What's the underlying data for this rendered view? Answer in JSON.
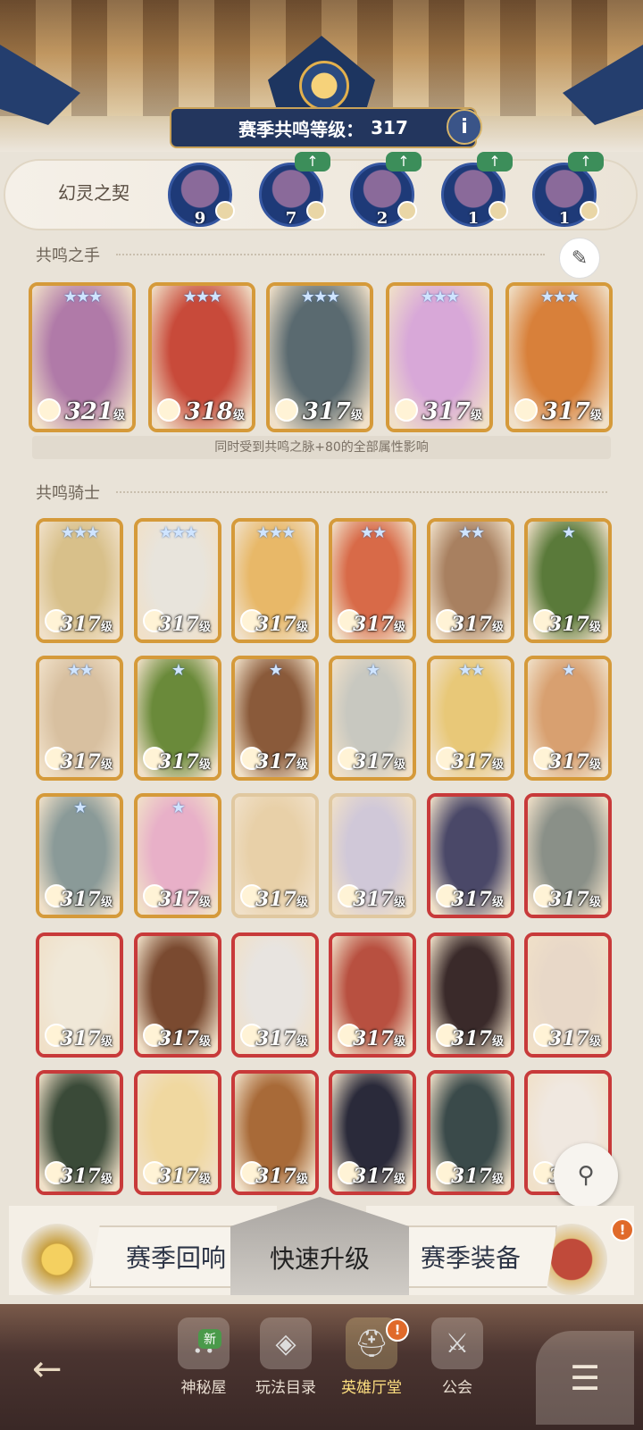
{
  "header": {
    "level_label": "赛季共鸣等级：",
    "level_value": "317",
    "info_label": "i"
  },
  "pact": {
    "label": "幻灵之契",
    "items": [
      {
        "count": "9",
        "upgrade": false
      },
      {
        "count": "7",
        "upgrade": true
      },
      {
        "count": "2",
        "upgrade": true
      },
      {
        "count": "1",
        "upgrade": true
      },
      {
        "count": "1",
        "upgrade": true
      }
    ],
    "upgrade_symbol": "↑"
  },
  "hands": {
    "title": "共鸣之手",
    "cards": [
      {
        "level": "321",
        "stars": "★★★",
        "color": "#b07aa8"
      },
      {
        "level": "318",
        "stars": "★★★",
        "color": "#c84a3a"
      },
      {
        "level": "317",
        "stars": "★★★",
        "color": "#5a6a70"
      },
      {
        "level": "317",
        "stars": "★★★",
        "color": "#d8a8d8"
      },
      {
        "level": "317",
        "stars": "★★★",
        "color": "#d8803a"
      }
    ],
    "note": "同时受到共鸣之脉+80的全部属性影响"
  },
  "knights": {
    "title": "共鸣骑士",
    "level_unit": "级",
    "rows": [
      [
        {
          "level": "317",
          "stars": "★★★",
          "color": "#d8c08a",
          "frame": "#d59a3a"
        },
        {
          "level": "317",
          "stars": "★★★",
          "color": "#e8e4dc",
          "frame": "#d59a3a"
        },
        {
          "level": "317",
          "stars": "★★★",
          "color": "#e8b868",
          "frame": "#d59a3a"
        },
        {
          "level": "317",
          "stars": "★★",
          "color": "#d86a48",
          "frame": "#d59a3a"
        },
        {
          "level": "317",
          "stars": "★★",
          "color": "#a88060",
          "frame": "#d59a3a"
        },
        {
          "level": "317",
          "stars": "★",
          "color": "#5a7a3a",
          "frame": "#d59a3a"
        }
      ],
      [
        {
          "level": "317",
          "stars": "★★",
          "color": "#d8c0a0",
          "frame": "#d59a3a"
        },
        {
          "level": "317",
          "stars": "★",
          "color": "#6a8a3a",
          "frame": "#d59a3a"
        },
        {
          "level": "317",
          "stars": "★",
          "color": "#8a5a3a",
          "frame": "#d59a3a"
        },
        {
          "level": "317",
          "stars": "★",
          "color": "#c8c8c0",
          "frame": "#d59a3a"
        },
        {
          "level": "317",
          "stars": "★★",
          "color": "#e8c878",
          "frame": "#d59a3a"
        },
        {
          "level": "317",
          "stars": "★",
          "color": "#d8a070",
          "frame": "#d59a3a"
        }
      ],
      [
        {
          "level": "317",
          "stars": "★",
          "color": "#8a9a98",
          "frame": "#d59a3a"
        },
        {
          "level": "317",
          "stars": "★",
          "color": "#e8b0c8",
          "frame": "#d59a3a"
        },
        {
          "level": "317",
          "stars": "",
          "color": "#e8d0a8",
          "frame": "#e0c8a0"
        },
        {
          "level": "317",
          "stars": "",
          "color": "#d0c8d8",
          "frame": "#e0c8a0"
        },
        {
          "level": "317",
          "stars": "",
          "color": "#4a4868",
          "frame": "#c83a3a"
        },
        {
          "level": "317",
          "stars": "",
          "color": "#8a9088",
          "frame": "#c83a3a"
        }
      ],
      [
        {
          "level": "317",
          "stars": "",
          "color": "#f0e8d8",
          "frame": "#c83a3a"
        },
        {
          "level": "317",
          "stars": "",
          "color": "#7a4a30",
          "frame": "#c83a3a"
        },
        {
          "level": "317",
          "stars": "",
          "color": "#e8e4e0",
          "frame": "#c83a3a"
        },
        {
          "level": "317",
          "stars": "",
          "color": "#b85040",
          "frame": "#c83a3a"
        },
        {
          "level": "317",
          "stars": "",
          "color": "#3a2a2a",
          "frame": "#c83a3a"
        },
        {
          "level": "317",
          "stars": "",
          "color": "#e8d8c8",
          "frame": "#c83a3a"
        }
      ],
      [
        {
          "level": "317",
          "stars": "",
          "color": "#3a4a38",
          "frame": "#c83a3a"
        },
        {
          "level": "317",
          "stars": "",
          "color": "#f0d8a0",
          "frame": "#c83a3a"
        },
        {
          "level": "317",
          "stars": "",
          "color": "#a86a38",
          "frame": "#c83a3a"
        },
        {
          "level": "317",
          "stars": "",
          "color": "#2a2a3a",
          "frame": "#c83a3a"
        },
        {
          "level": "317",
          "stars": "",
          "color": "#3a4a4a",
          "frame": "#c83a3a"
        },
        {
          "level": "317",
          "stars": "",
          "color": "#f0e8e0",
          "frame": "#c83a3a"
        }
      ]
    ]
  },
  "actions": {
    "season_echo": "赛季回响",
    "quick_upgrade": "快速升级",
    "season_gear": "赛季装备",
    "alert": "!"
  },
  "nav": {
    "back": "←",
    "items": [
      {
        "label": "神秘屋",
        "icon": "⛬",
        "badge": "新"
      },
      {
        "label": "玩法目录",
        "icon": "◈"
      },
      {
        "label": "英雄厅堂",
        "icon": "⛑",
        "active": true
      },
      {
        "label": "公会",
        "icon": "⚔"
      }
    ],
    "menu": "☰"
  }
}
